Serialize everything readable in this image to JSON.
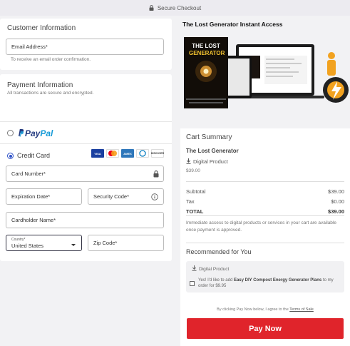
{
  "header": {
    "title": "Secure Checkout"
  },
  "customer": {
    "heading": "Customer Information",
    "email_placeholder": "Email Address*",
    "email_hint": "To receive an email order confirmation."
  },
  "payment": {
    "heading": "Payment Information",
    "subheading": "All transactions are secure and encrypted.",
    "paypal_label_1": "Pay",
    "paypal_label_2": "Pal",
    "credit_card_label": "Credit Card",
    "card_brands": [
      "VISA",
      "MC",
      "AMEX",
      "DC",
      "DISCOVER"
    ],
    "card_number_placeholder": "Card Number*",
    "expiration_placeholder": "Expiration Date*",
    "security_code_placeholder": "Security Code*",
    "cardholder_placeholder": "Cardholder Name*",
    "country_label": "Country*",
    "country_value": "United States",
    "zip_placeholder": "Zip Code*"
  },
  "product": {
    "title": "The Lost Generator Instant Access",
    "cover_line1": "THE LOST",
    "cover_line2": "GENERATOR"
  },
  "summary": {
    "heading": "Cart Summary",
    "product_name": "The Lost Generator",
    "product_type": "Digital Product",
    "product_price": "$39.00",
    "subtotal_label": "Subtotal",
    "subtotal_value": "$39.00",
    "tax_label": "Tax",
    "tax_value": "$0.00",
    "total_label": "TOTAL",
    "total_value": "$39.00",
    "note": "Immediate access to digital products or services in your cart are available once payment is approved."
  },
  "recommended": {
    "heading": "Recommended for You",
    "type": "Digital Product",
    "offer_prefix": "Yes! I'd like to add ",
    "offer_bold": "Easy DIY Compost Energy Generator Plans",
    "offer_suffix": " to my order for $9.95"
  },
  "footer": {
    "terms_prefix": "By clicking Pay Now below, I agree to the ",
    "terms_link": "Terms of Sale",
    "pay_button": "Pay Now"
  },
  "colors": {
    "pay_button": "#e0242b",
    "accent": "#2b4fc7"
  }
}
